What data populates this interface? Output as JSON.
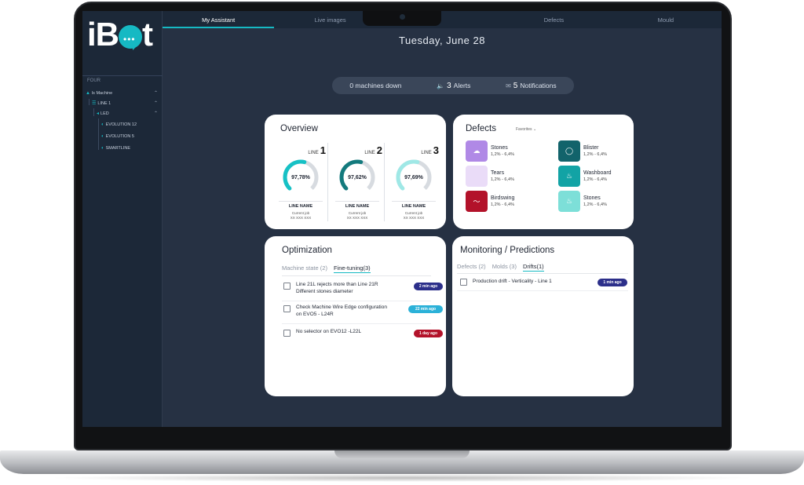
{
  "sidebar": {
    "logo": "iBot",
    "section": "FOUR",
    "tree": [
      {
        "label": "ls Machine",
        "level": 0
      },
      {
        "label": "LINE 1",
        "level": 1
      },
      {
        "label": "LED",
        "level": 2
      },
      {
        "label": "EVOLUTION 12",
        "level": 3
      },
      {
        "label": "EVOLUTION 5",
        "level": 3
      },
      {
        "label": "SMARTLINE",
        "level": 3
      }
    ]
  },
  "tabs": [
    "My Assistant",
    "Live images",
    "",
    "Defects",
    "Mould"
  ],
  "active_tab": "My Assistant",
  "date": "Tuesday, June 28",
  "status": {
    "machines_down": "0 machines down",
    "alerts_num": "3",
    "alerts_label": "Alerts",
    "notif_num": "5",
    "notif_label": "Notifications"
  },
  "overview": {
    "title": "Overview",
    "line_prefix": "LINE",
    "lines": [
      {
        "num": "1",
        "value": "97,78%",
        "pct": 97.78,
        "name": "LINE NAME",
        "job_label": "Current job",
        "job": "XX XXX XXX",
        "color": "#16c1c5"
      },
      {
        "num": "2",
        "value": "97,62%",
        "pct": 97.62,
        "name": "LINE NAME",
        "job_label": "Current job",
        "job": "XX XXX XXX",
        "color": "#137a7d"
      },
      {
        "num": "3",
        "value": "97,69%",
        "pct": 97.69,
        "name": "LINE NAME",
        "job_label": "Current job",
        "job": "XX XXX XXX",
        "color": "#9fe8e6"
      }
    ]
  },
  "defects": {
    "title": "Defects",
    "filter": "Favorites",
    "items": [
      {
        "name": "Stones",
        "range": "1,2% - 6,4%",
        "color": "#b089e6"
      },
      {
        "name": "Tears",
        "range": "1,2% - 6,4%",
        "color": "#eadcf8"
      },
      {
        "name": "Birdswing",
        "range": "1,2% - 6,4%",
        "color": "#b3122a"
      },
      {
        "name": "Blister",
        "range": "1,2% - 6,4%",
        "color": "#12636b"
      },
      {
        "name": "Washboard",
        "range": "1,2% - 6,4%",
        "color": "#12a3a5"
      },
      {
        "name": "Stones",
        "range": "1,2% - 6,4%",
        "color": "#7ddfd8"
      }
    ]
  },
  "optimization": {
    "title": "Optimization",
    "tabs": [
      "Machine state (2)",
      "Fine-tuning(3)"
    ],
    "active": 1,
    "tasks": [
      {
        "line1": "Line 21L rejects more than Line 21R",
        "line2": "Different stones diameter",
        "badge": "2 min ago",
        "badge_color": "#2c2f8a"
      },
      {
        "line1": "Check Machine Wire Edge configuration",
        "line2": "on EVO5 - L24R",
        "badge": "22 min ago",
        "badge_color": "#2bb1d8"
      },
      {
        "line1": "No selector on EVO12 -L22L",
        "line2": "",
        "badge": "1 day ago",
        "badge_color": "#b3122a"
      }
    ]
  },
  "monitoring": {
    "title": "Monitoring / Predictions",
    "tabs": [
      "Defects (2)",
      "Molds (3)",
      "Drifts(1)"
    ],
    "active": 2,
    "tasks": [
      {
        "line1": "Production drift - Verticality - Line 1",
        "badge": "1 min ago",
        "badge_color": "#2c2f8a"
      }
    ]
  }
}
